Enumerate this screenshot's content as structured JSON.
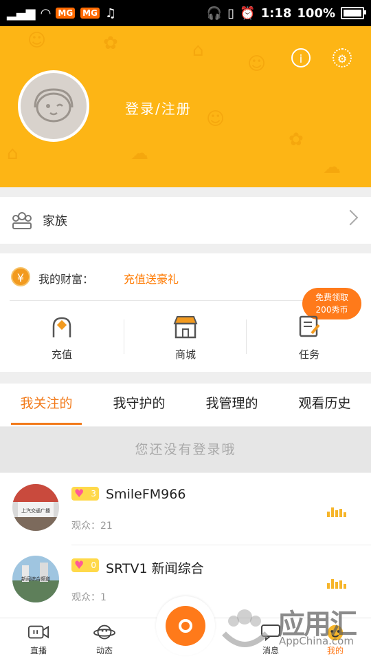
{
  "status_bar": {
    "time": "1:18",
    "battery": "100%"
  },
  "header": {
    "login_label": "登录/注册",
    "info_icon": "info-icon",
    "settings_icon": "gear-icon"
  },
  "family": {
    "label": "家族"
  },
  "wealth": {
    "label": "我的财富：",
    "promo": "充值送豪礼",
    "free_badge_line1": "免费领取",
    "free_badge_line2": "200秀币",
    "actions": [
      {
        "label": "充值",
        "icon": "recharge-icon"
      },
      {
        "label": "商城",
        "icon": "shop-icon"
      },
      {
        "label": "任务",
        "icon": "task-icon"
      }
    ]
  },
  "tabs": [
    {
      "label": "我关注的",
      "active": true
    },
    {
      "label": "我守护的",
      "active": false
    },
    {
      "label": "我管理的",
      "active": false
    },
    {
      "label": "观看历史",
      "active": false
    }
  ],
  "notice": "您还没有登录哦",
  "list": [
    {
      "name": "SmileFM966",
      "badge": "3",
      "viewers": "观众：21",
      "thumb_text": "上汽交通广播"
    },
    {
      "name": "SRTV1 新闻综合",
      "badge": "0",
      "viewers": "观众：1",
      "thumb_text": "新闻综合频道"
    }
  ],
  "bottom_nav": [
    {
      "label": "直播",
      "icon": "live-icon"
    },
    {
      "label": "动态",
      "icon": "planet-icon"
    },
    {
      "label": "消息",
      "icon": "message-icon"
    },
    {
      "label": "我的",
      "icon": "me-icon"
    }
  ],
  "watermark": {
    "cn": "应用汇",
    "en": "AppChina.com"
  },
  "colors": {
    "brand": "#fdb515",
    "accent": "#ff7a1a"
  }
}
